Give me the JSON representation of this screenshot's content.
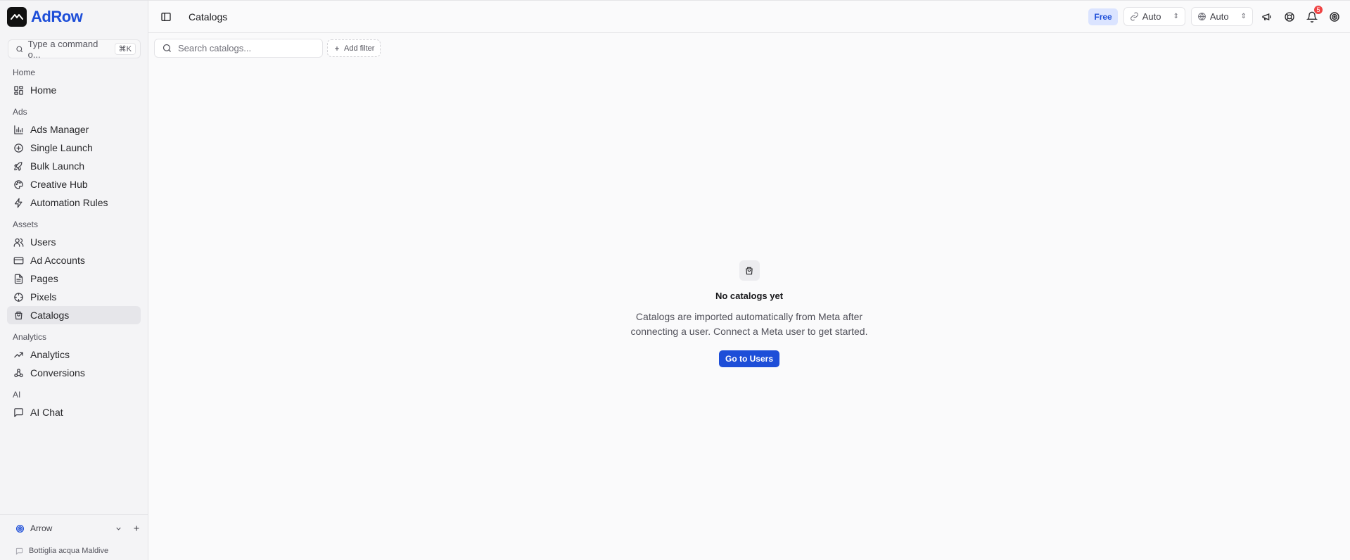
{
  "app": {
    "name": "AdRow"
  },
  "command": {
    "placeholder": "Type a command o...",
    "shortcut": "⌘K"
  },
  "sidebar": {
    "groups": [
      {
        "label": "Home",
        "items": [
          {
            "label": "Home",
            "icon": "dashboard-icon"
          }
        ]
      },
      {
        "label": "Ads",
        "items": [
          {
            "label": "Ads Manager",
            "icon": "bar-chart-icon"
          },
          {
            "label": "Single Launch",
            "icon": "plus-circle-icon"
          },
          {
            "label": "Bulk Launch",
            "icon": "rocket-icon"
          },
          {
            "label": "Creative Hub",
            "icon": "palette-icon"
          },
          {
            "label": "Automation Rules",
            "icon": "zap-icon"
          }
        ]
      },
      {
        "label": "Assets",
        "items": [
          {
            "label": "Users",
            "icon": "users-icon"
          },
          {
            "label": "Ad Accounts",
            "icon": "credit-card-icon"
          },
          {
            "label": "Pages",
            "icon": "file-text-icon"
          },
          {
            "label": "Pixels",
            "icon": "target-icon"
          },
          {
            "label": "Catalogs",
            "icon": "shopping-bag-icon",
            "active": true
          }
        ]
      },
      {
        "label": "Analytics",
        "items": [
          {
            "label": "Analytics",
            "icon": "trend-up-icon"
          },
          {
            "label": "Conversions",
            "icon": "webhook-icon"
          }
        ]
      },
      {
        "label": "AI",
        "items": [
          {
            "label": "AI Chat",
            "icon": "message-square-icon"
          }
        ]
      }
    ],
    "workspace": {
      "name": "Arrow"
    },
    "account": {
      "name": "Bottiglia acqua Maldive"
    }
  },
  "header": {
    "title": "Catalogs",
    "plan_badge": "Free",
    "select_a": "Auto",
    "select_b": "Auto",
    "notification_count": "5"
  },
  "toolbar": {
    "search_placeholder": "Search catalogs...",
    "add_filter": "Add filter"
  },
  "empty_state": {
    "title": "No catalogs yet",
    "description": "Catalogs are imported automatically from Meta after connecting a user. Connect a Meta user to get started.",
    "button": "Go to Users"
  },
  "colors": {
    "accent": "#1d4ed8",
    "badge_bg": "#dbe4ff",
    "notification": "#ef4444"
  }
}
